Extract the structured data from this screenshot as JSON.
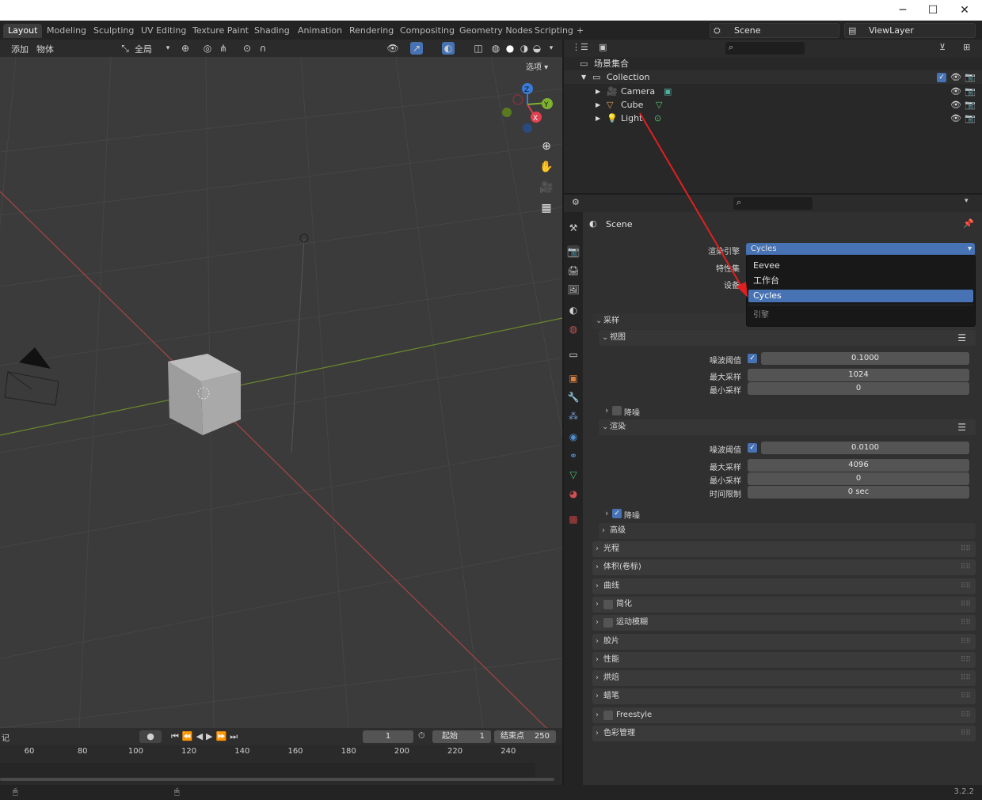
{
  "window": {
    "minimize": "─",
    "maximize": "☐",
    "close": "✕"
  },
  "workspace_tabs": [
    "Layout",
    "Modeling",
    "Sculpting",
    "UV Editing",
    "Texture Paint",
    "Shading",
    "Animation",
    "Rendering",
    "Compositing",
    "Geometry Nodes",
    "Scripting",
    "+"
  ],
  "scene_name": "Scene",
  "view_layer_name": "ViewLayer",
  "viewport": {
    "menu_add": "添加",
    "menu_object": "物体",
    "transform_orientation": "全局",
    "options_label": "选项",
    "gizmo": {
      "z": "Z",
      "y": "Y",
      "x": "X"
    }
  },
  "outliner": {
    "root": "场景集合",
    "collection": "Collection",
    "items": [
      {
        "name": "Camera",
        "icon": "camera-icon",
        "color": "#e0a050"
      },
      {
        "name": "Cube",
        "icon": "mesh-icon",
        "color": "#e0a050"
      },
      {
        "name": "Light",
        "icon": "light-icon",
        "color": "#e0a050"
      }
    ]
  },
  "properties": {
    "context_title": "Scene",
    "render_engine_label": "渲染引擎",
    "render_engine_value": "Cycles",
    "feature_set_label": "特性集",
    "device_label": "设备",
    "dropdown": {
      "options": [
        "Eevee",
        "工作台",
        "Cycles"
      ],
      "selected": "Cycles",
      "footer": "引擎"
    },
    "sampling": {
      "title": "采样",
      "viewport": {
        "title": "视图",
        "noise_threshold_label": "噪波阈值",
        "noise_threshold_value": "0.1000",
        "max_samples_label": "最大采样",
        "max_samples_value": "1024",
        "min_samples_label": "最小采样",
        "min_samples_value": "0",
        "denoise_label": "降噪"
      },
      "render": {
        "title": "渲染",
        "noise_threshold_label": "噪波阈值",
        "noise_threshold_value": "0.0100",
        "max_samples_label": "最大采样",
        "max_samples_value": "4096",
        "min_samples_label": "最小采样",
        "min_samples_value": "0",
        "time_limit_label": "时间限制",
        "time_limit_value": "0 sec",
        "denoise_label": "降噪"
      },
      "advanced": "高级"
    },
    "panels": [
      "光程",
      "体积(卷标)",
      "曲线",
      "简化",
      "运动模糊",
      "胶片",
      "性能",
      "烘焙",
      "蜡笔",
      "Freestyle",
      "色彩管理"
    ]
  },
  "timeline": {
    "marker_label": "记",
    "current_frame": "1",
    "start_label": "起始",
    "start_value": "1",
    "end_label": "结束点",
    "end_value": "250",
    "ticks": [
      "60",
      "80",
      "100",
      "120",
      "140",
      "160",
      "180",
      "200",
      "220",
      "240"
    ]
  },
  "status": {
    "version": "3.2.2"
  }
}
